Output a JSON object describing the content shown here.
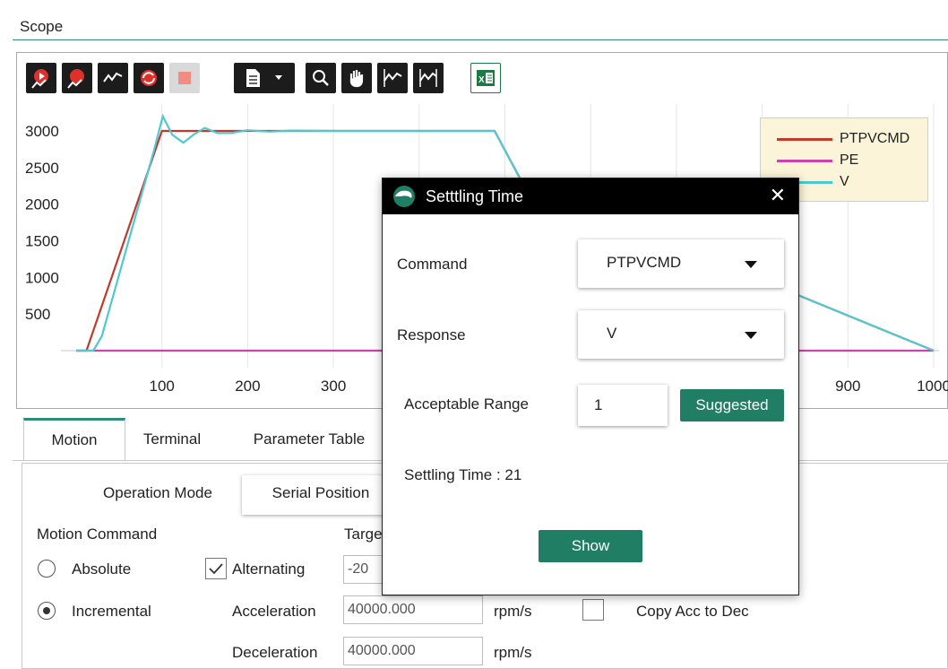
{
  "scope": {
    "title": "Scope",
    "toolbar_icons": [
      "record-start-icon",
      "record-stop-icon",
      "signal-icon",
      "auto-refresh-icon",
      "stop-icon",
      "document-menu-icon",
      "zoom-icon",
      "pan-hand-icon",
      "cursor-wave-icon",
      "split-wave-icon",
      "excel-export-icon"
    ]
  },
  "chart_data": {
    "type": "line",
    "x_ticks": [
      100,
      200,
      300,
      900,
      1000
    ],
    "y_ticks": [
      500,
      1000,
      1500,
      2000,
      2500,
      3000
    ],
    "xlim": [
      0,
      1000
    ],
    "ylim": [
      0,
      3200
    ],
    "grid": true,
    "legend_placement": "top-right",
    "series": [
      {
        "name": "PTPVCMD",
        "color": "#c0392b",
        "x": [
          0,
          12,
          100,
          488,
          520,
          1000
        ],
        "y": [
          0,
          0,
          3000,
          3000,
          2300,
          0
        ]
      },
      {
        "name": "PE",
        "color": "#cc44aa",
        "x": [
          0,
          1000
        ],
        "y": [
          0,
          0
        ]
      },
      {
        "name": "V",
        "color": "#4ec9d0",
        "x": [
          0,
          20,
          30,
          90,
          101,
          112,
          125,
          137,
          150,
          165,
          180,
          200,
          225,
          250,
          300,
          400,
          488,
          520,
          1000
        ],
        "y": [
          0,
          0,
          200,
          2700,
          3200,
          2950,
          2840,
          2950,
          3040,
          2970,
          2970,
          3010,
          2990,
          3005,
          3000,
          3000,
          3000,
          2300,
          0
        ]
      }
    ]
  },
  "tabs": [
    "Motion",
    "Terminal",
    "Parameter Table"
  ],
  "motion": {
    "sub_tabs": [
      "Operation Mode",
      "Serial Position"
    ],
    "motion_command_label": "Motion Command",
    "target_label": "Targe",
    "absolute_label": "Absolute",
    "incremental_label": "Incremental",
    "alternating_label": "Alternating",
    "target_value": "-20",
    "acceleration_label": "Acceleration",
    "acceleration_value": "40000.000",
    "acceleration_unit": "rpm/s",
    "deceleration_label": "Deceleration",
    "deceleration_value": "40000.000",
    "deceleration_unit": "rpm/s",
    "copy_acc_label": "Copy Acc to Dec"
  },
  "dialog": {
    "title": "Setttling Time",
    "close_glyph": "✕",
    "command_label": "Command",
    "command_value": "PTPVCMD",
    "response_label": "Response",
    "response_value": "V",
    "range_label": "Acceptable Range",
    "range_value": "1",
    "suggested_button": "Suggested",
    "settling_text": "Settling Time : 21",
    "show_button": "Show"
  }
}
